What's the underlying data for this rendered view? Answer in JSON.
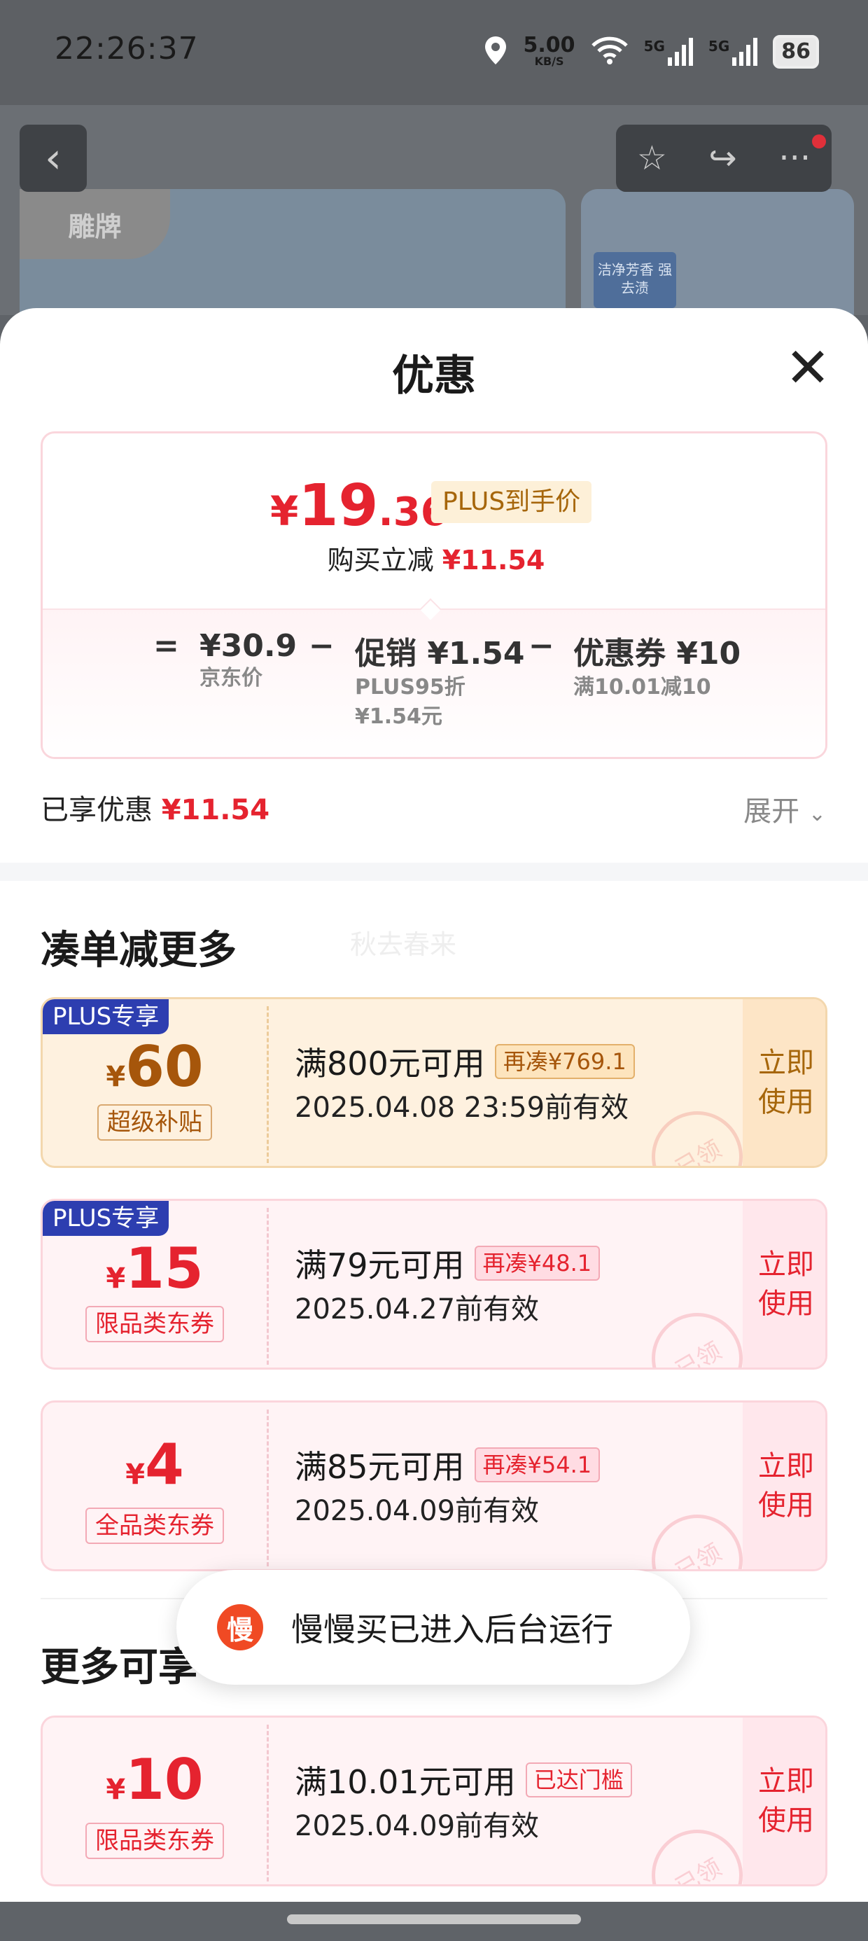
{
  "status_bar": {
    "time": "22:26:37",
    "net_speed": "5.00",
    "net_unit": "KB/S",
    "signal1": "5G",
    "signal2": "5G",
    "battery": "86"
  },
  "background": {
    "brand_logo": "雕牌",
    "product_tag": "洁净芳香 强去渍"
  },
  "sheet": {
    "title": "优惠",
    "summary": {
      "price_yen": "¥",
      "price_int": "19",
      "price_dec": ".36",
      "price_tag": "PLUS到手价",
      "reduce_label": "购买立减",
      "reduce_amount": "¥11.54",
      "eq": "=",
      "jd_price": "¥30.9",
      "jd_price_label": "京东价",
      "minus1": "−",
      "promo": "促销 ¥1.54",
      "promo_sub1": "PLUS95折",
      "promo_sub2": "¥1.54元",
      "minus2": "−",
      "coupon": "优惠券 ¥10",
      "coupon_sub": "满10.01减10"
    },
    "enjoyed_label": "已享优惠",
    "enjoyed_amount": "¥11.54",
    "expand_label": "展开"
  },
  "section1": {
    "title": "凑单减更多",
    "watermark": "秋去春来"
  },
  "coupons": [
    {
      "badge": "PLUS专享",
      "yen": "¥",
      "amount": "60",
      "type": "超级补贴",
      "condition": "满800元可用",
      "tag": "再凑¥769.1",
      "date": "2025.04.08 23:59前有效",
      "use": "立即使用",
      "stamp": "已领"
    },
    {
      "badge": "PLUS专享",
      "yen": "¥",
      "amount": "15",
      "type": "限品类东券",
      "condition": "满79元可用",
      "tag": "再凑¥48.1",
      "date": "2025.04.27前有效",
      "use": "立即使用",
      "stamp": "已领"
    },
    {
      "yen": "¥",
      "amount": "4",
      "type": "全品类东券",
      "condition": "满85元可用",
      "tag": "再凑¥54.1",
      "date": "2025.04.09前有效",
      "use": "立即使用",
      "stamp": "已领"
    }
  ],
  "section2": {
    "title": "更多可享"
  },
  "coupon_more": {
    "yen": "¥",
    "amount": "10",
    "type": "限品类东券",
    "condition": "满10.01元可用",
    "tag": "已达门槛",
    "date": "2025.04.09前有效",
    "use": "立即使用",
    "stamp": "已领"
  },
  "toast": {
    "icon_char": "慢",
    "text": "慢慢买已进入后台运行"
  }
}
